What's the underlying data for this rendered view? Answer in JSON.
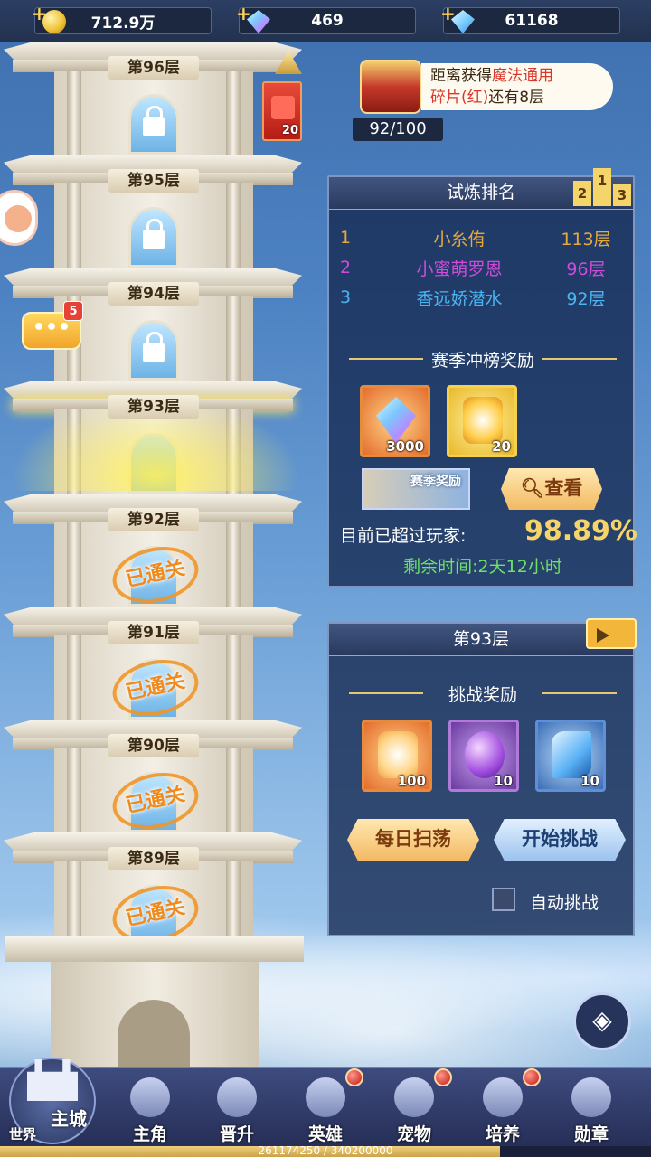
{
  "resources": [
    {
      "icon": "gold-coin-icon",
      "value": "712.9万"
    },
    {
      "icon": "rainbow-diamond-icon",
      "value": "469"
    },
    {
      "icon": "blue-diamond-icon",
      "value": "61168"
    }
  ],
  "tower": {
    "floors": [
      {
        "label": "第96层",
        "state": "locked"
      },
      {
        "label": "第95层",
        "state": "locked"
      },
      {
        "label": "第94层",
        "state": "locked"
      },
      {
        "label": "第93层",
        "state": "current"
      },
      {
        "label": "第92层",
        "state": "cleared"
      },
      {
        "label": "第91层",
        "state": "cleared"
      },
      {
        "label": "第90层",
        "state": "cleared"
      },
      {
        "label": "第89层",
        "state": "cleared"
      }
    ],
    "cleared_text": "已通关"
  },
  "puzzle_piece": {
    "count": "20"
  },
  "chat": {
    "badge": "5"
  },
  "reward_notice": {
    "prefix": "距离获得",
    "highlight": "魔法通用",
    "line2a": "碎片(红)",
    "line2b": "还有8层",
    "progress": "92/100"
  },
  "ranking": {
    "title": "试炼排名",
    "rows": [
      {
        "rank": "1",
        "name": "小糸侑",
        "floor": "113层",
        "color": "#e8a93c"
      },
      {
        "rank": "2",
        "name": "小蜜萌罗恩",
        "floor": "96层",
        "color": "#d04bdc"
      },
      {
        "rank": "3",
        "name": "香远娇潜水",
        "floor": "92层",
        "color": "#4cb4f0"
      }
    ],
    "season_title": "赛季冲榜奖励",
    "season_items": [
      {
        "icon": "diamond-icon",
        "qty": "3000"
      },
      {
        "icon": "flame-icon",
        "qty": "20"
      }
    ],
    "season_badge": "赛季奖励",
    "view_label": "查看",
    "exceed_label": "目前已超过玩家:",
    "exceed_value": "98.89%",
    "remaining": "剩余时间:2天12小时"
  },
  "challenge": {
    "title": "第93层",
    "rewards_title": "挑战奖励",
    "items": [
      {
        "icon": "spirit-flame-icon",
        "qty": "100"
      },
      {
        "icon": "crystal-ball-icon",
        "qty": "10"
      },
      {
        "icon": "potion-icon",
        "qty": "10"
      }
    ],
    "sweep_label": "每日扫荡",
    "start_label": "开始挑战",
    "auto_label": "自动挑战"
  },
  "nav": {
    "home": {
      "label": "主城",
      "sub": "世界"
    },
    "items": [
      {
        "label": "主角",
        "dot": false
      },
      {
        "label": "晋升",
        "dot": false
      },
      {
        "label": "英雄",
        "dot": true
      },
      {
        "label": "宠物",
        "dot": true
      },
      {
        "label": "培养",
        "dot": true
      },
      {
        "label": "勋章",
        "dot": false
      }
    ]
  },
  "exp": {
    "text": "261174250 / 340200000",
    "fraction": 0.7677
  }
}
